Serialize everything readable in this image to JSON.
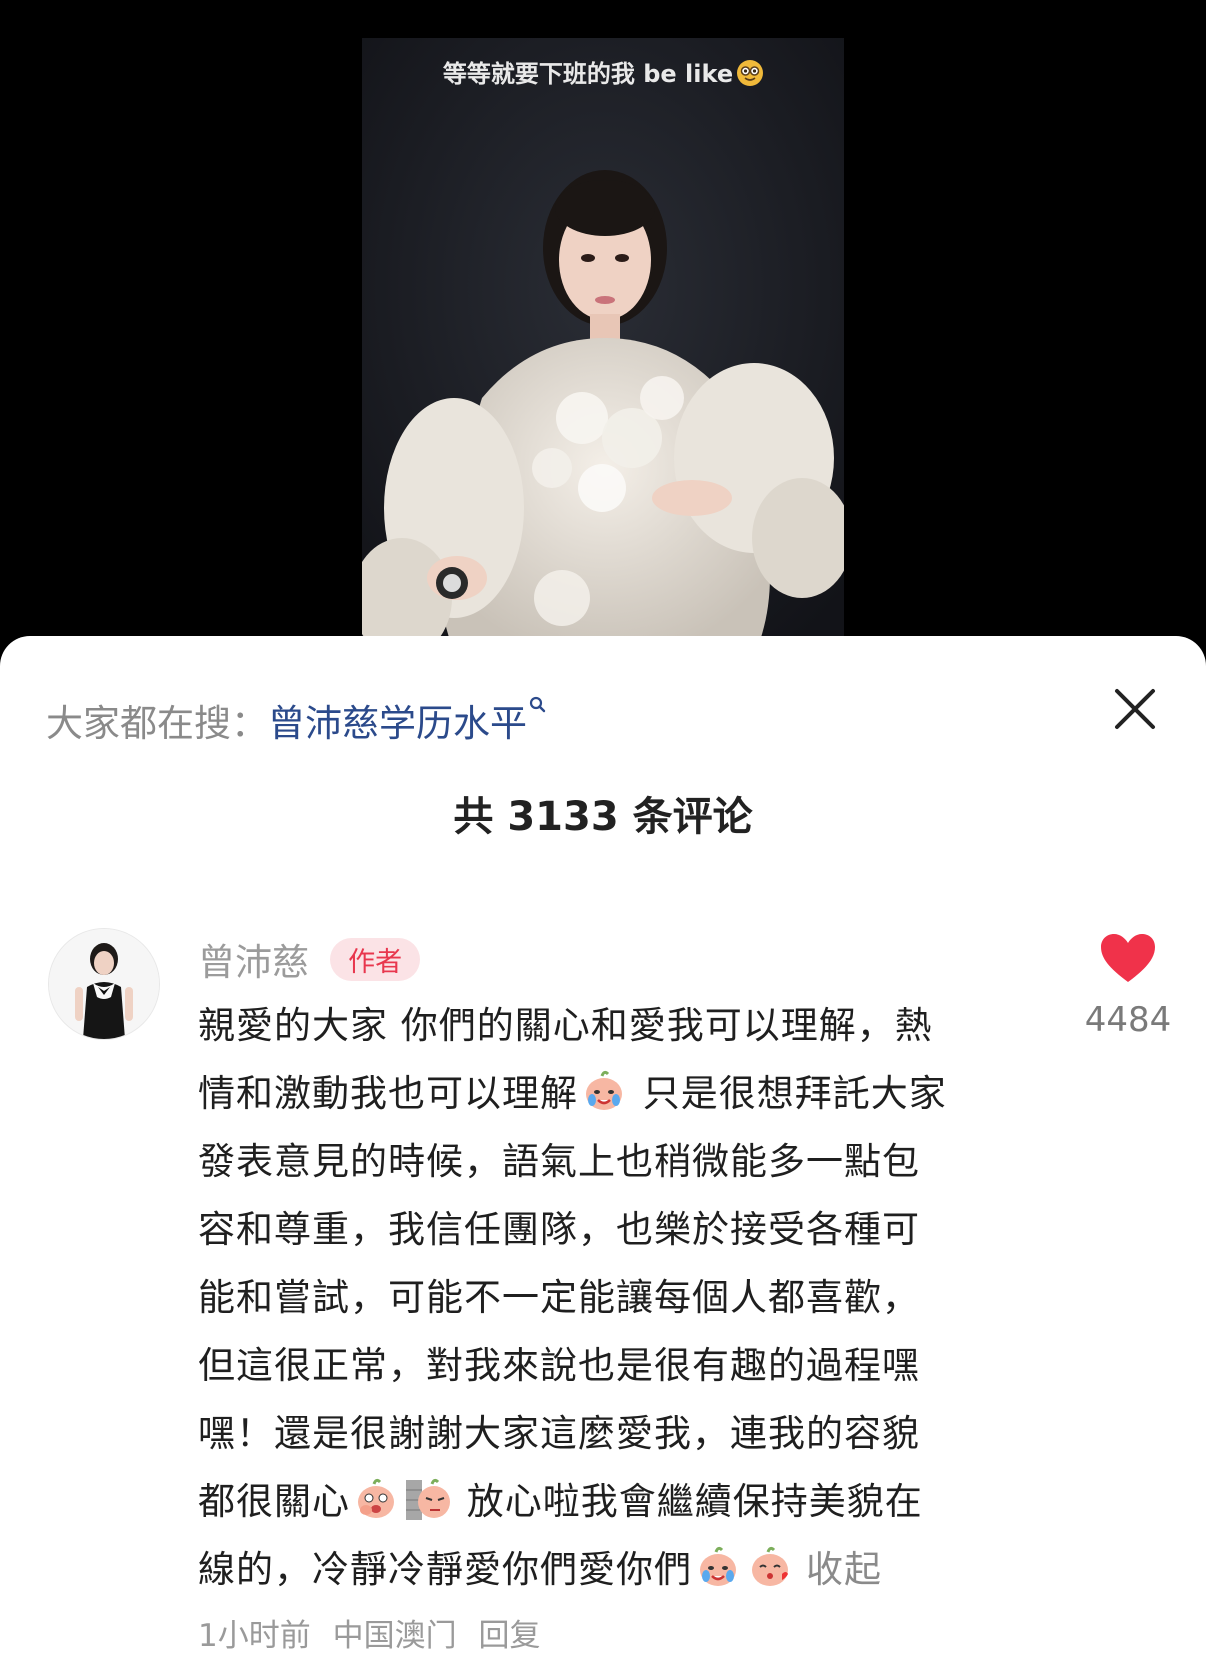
{
  "video": {
    "caption": "等等就要下班的我 be like",
    "caption_emoji_icon": "nerd-face-icon"
  },
  "search_suggestion": {
    "prefix": "大家都在搜：",
    "term": "曾沛慈学历水平",
    "icon": "search-icon"
  },
  "close_icon": "close-icon",
  "comments_header": {
    "title": "共 3133 条评论"
  },
  "comment": {
    "author": "曾沛慈",
    "badge": "作者",
    "lines": [
      "親愛的大家 你們的關心和愛我可以理解，熱",
      "情和激動我也可以理解",
      " 只是很想拜託大家",
      "發表意見的時候，語氣上也稍微能多一點包",
      "容和尊重，我信任團隊，也樂於接受各種可",
      "能和嘗試，可能不一定能讓每個人都喜歡，",
      "但這很正常，對我來說也是很有趣的過程嘿",
      "嘿！還是很謝謝大家這麼愛我，連我的容貌",
      "都很關心",
      " 放心啦我會繼續保持美貌在",
      "線的，冷靜冷靜愛你們愛你們"
    ],
    "collapse_label": "收起",
    "time": "1小时前",
    "location": "中国澳门",
    "reply_label": "回复",
    "like_count": "4484",
    "like_icon": "heart-icon",
    "emoji_icons": [
      "crying-peach-icon",
      "peeking-peach-icon",
      "wall-peeking-peach-icon",
      "crying-peach-icon",
      "kissing-peach-icon"
    ]
  },
  "colors": {
    "badge_text": "#e8374e",
    "badge_bg": "#fbe3e6",
    "search_term": "#2b4a8b",
    "heart": "#f0324a"
  }
}
